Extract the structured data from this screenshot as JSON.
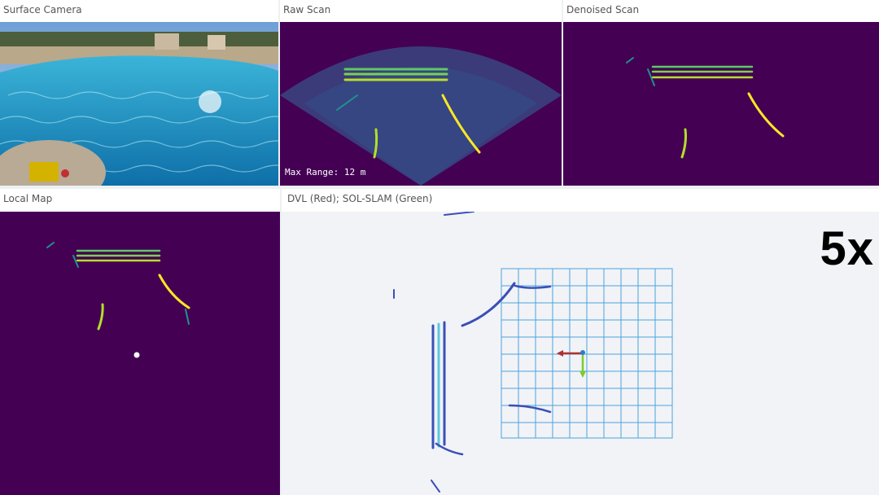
{
  "panels": {
    "surface_camera": {
      "title": "Surface Camera"
    },
    "raw_scan": {
      "title": "Raw Scan",
      "overlay_text": "Max Range:  12 m"
    },
    "denoised_scan": {
      "title": "Denoised Scan"
    },
    "local_map": {
      "title": "Local Map"
    },
    "trajectory": {
      "title": "DVL (Red); SOL-SLAM (Green)",
      "playback_speed": "5x"
    }
  },
  "colors": {
    "sonar_background": "#440154",
    "viridis_mid": "#21918c",
    "viridis_high": "#fde725",
    "grid_line": "#4aa3df",
    "dvl_arrow": "#b03030",
    "slam_arrow": "#7ccc2e"
  },
  "icons": {
    "camera_marker": "dot"
  }
}
